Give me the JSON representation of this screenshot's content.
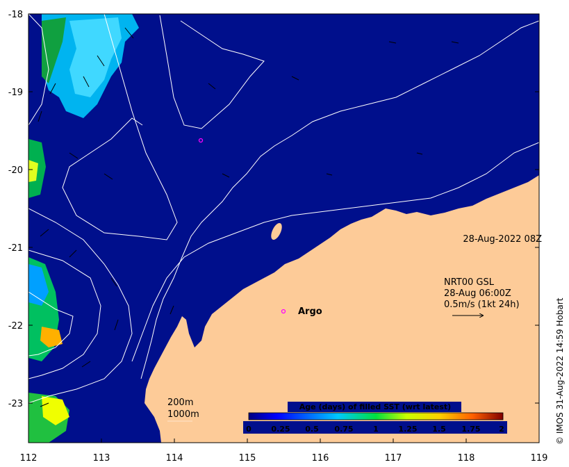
{
  "map": {
    "timestamp": "28-Aug-2022 08Z",
    "current_legend": {
      "line1": "NRT00 GSL",
      "line2": "28-Aug 06:00Z",
      "line3": "0.5m/s (1kt 24h)"
    },
    "isobaths": {
      "line1": "200m",
      "line2": "1000m"
    },
    "argo_label": "Argo",
    "copyright": "© IMOS 31-Aug-2022 14:59 Hobart",
    "x_ticks": [
      "112",
      "113",
      "114",
      "115",
      "116",
      "117",
      "118",
      "119"
    ],
    "y_ticks": [
      "-18",
      "-19",
      "-20",
      "-21",
      "-22",
      "-23"
    ],
    "x_range": [
      112,
      119
    ],
    "y_range": [
      -17.98,
      -23.5
    ],
    "colorbar": {
      "title": "Age (days) of filled SST (wrt latest)",
      "ticks": [
        "0",
        "0.25",
        "0.5",
        "0.75",
        "1",
        "1.25",
        "1.5",
        "1.75",
        "2"
      ],
      "range": [
        0,
        2
      ]
    },
    "floats": [
      {
        "name": "float-offshore",
        "lon": 114.37,
        "lat": -19.62
      },
      {
        "name": "float-argo",
        "lon": 115.48,
        "lat": -21.82
      }
    ],
    "colors": {
      "ocean": "#000f8c",
      "land": "#fdcb98",
      "float_marker": "#ff00ff",
      "isobath": "#ffffff"
    }
  }
}
